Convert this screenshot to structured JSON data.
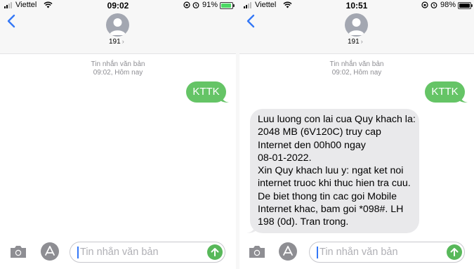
{
  "screens": [
    {
      "status": {
        "carrier": "Viettel",
        "time": "09:02",
        "battery_percent": "91%",
        "battery_level": 0.91,
        "battery_color": "#4cd964"
      },
      "contact": {
        "name": "191",
        "chevron": "›"
      },
      "thread": {
        "type_label": "Tin nhắn văn bản",
        "timestamp": "09:02, Hôm nay"
      },
      "messages": [
        {
          "direction": "outgoing",
          "text": "KTTK"
        }
      ],
      "composer": {
        "placeholder": "Tin nhắn văn bản"
      }
    },
    {
      "status": {
        "carrier": "Viettel",
        "time": "10:51",
        "battery_percent": "98%",
        "battery_level": 0.98,
        "battery_color": "#000000"
      },
      "contact": {
        "name": "191",
        "chevron": "›"
      },
      "thread": {
        "type_label": "Tin nhắn văn bản",
        "timestamp": "09:02, Hôm nay"
      },
      "messages": [
        {
          "direction": "outgoing",
          "text": "KTTK"
        },
        {
          "direction": "incoming",
          "lines": [
            "Luu luong con lai cua Quy khach la:",
            "2048 MB (6V120C) truy cap",
            "Internet den 00h00 ngay",
            "08-01-2022.",
            "Xin Quy khach luu y: ngat ket noi",
            "internet truoc khi thuc hien tra cuu.",
            "De biet thong tin cac goi Mobile",
            "Internet khac, bam goi *098#. LH",
            "198 (0d). Tran trong."
          ]
        }
      ],
      "composer": {
        "placeholder": "Tin nhắn văn bản"
      }
    }
  ],
  "colors": {
    "accent": "#3478f6",
    "outgoing_bubble": "#65c466",
    "incoming_bubble": "#e9e9eb",
    "send_button": "#58b85a"
  },
  "icons": [
    "back-chevron-icon",
    "avatar-person-icon",
    "camera-icon",
    "app-store-icon",
    "send-arrow-icon",
    "wifi-icon",
    "lock-rotation-icon",
    "alarm-icon",
    "battery-icon"
  ]
}
